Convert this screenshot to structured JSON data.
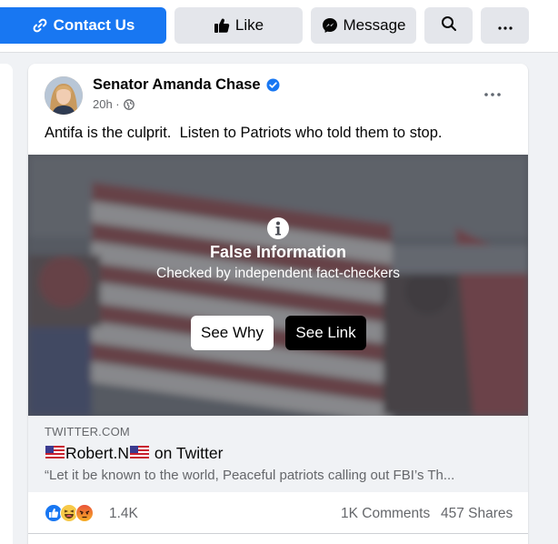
{
  "page_actions": {
    "contact_label": "Contact Us",
    "like_label": "Like",
    "message_label": "Message"
  },
  "post": {
    "author": "Senator Amanda Chase",
    "time": "20h · ",
    "text": "Antifa is the culprit.  Listen to Patriots who told them to stop.",
    "fact_check": {
      "title": "False Information",
      "subtitle": "Checked by independent fact-checkers",
      "see_why": "See Why",
      "see_link": "See Link"
    },
    "link": {
      "domain": "TWITTER.COM",
      "title_name": "Robert.N",
      "title_suffix": " on Twitter",
      "description": "“Let it be known to the world, Peaceful patriots calling out FBI’s Th..."
    },
    "stats": {
      "reactions": "1.4K",
      "comments": "1K Comments",
      "shares": "457 Shares"
    }
  },
  "icons": [
    "link-icon",
    "thumbs-up-icon",
    "messenger-icon",
    "search-icon",
    "more-icon",
    "verified-icon",
    "globe-icon",
    "info-icon",
    "us-flag-icon",
    "like-reaction-icon",
    "haha-reaction-icon",
    "angry-reaction-icon"
  ],
  "colors": {
    "brand_blue": "#1877f2",
    "button_gray": "#e4e6eb",
    "secondary_text": "#65676b",
    "overlay": "#464850"
  }
}
